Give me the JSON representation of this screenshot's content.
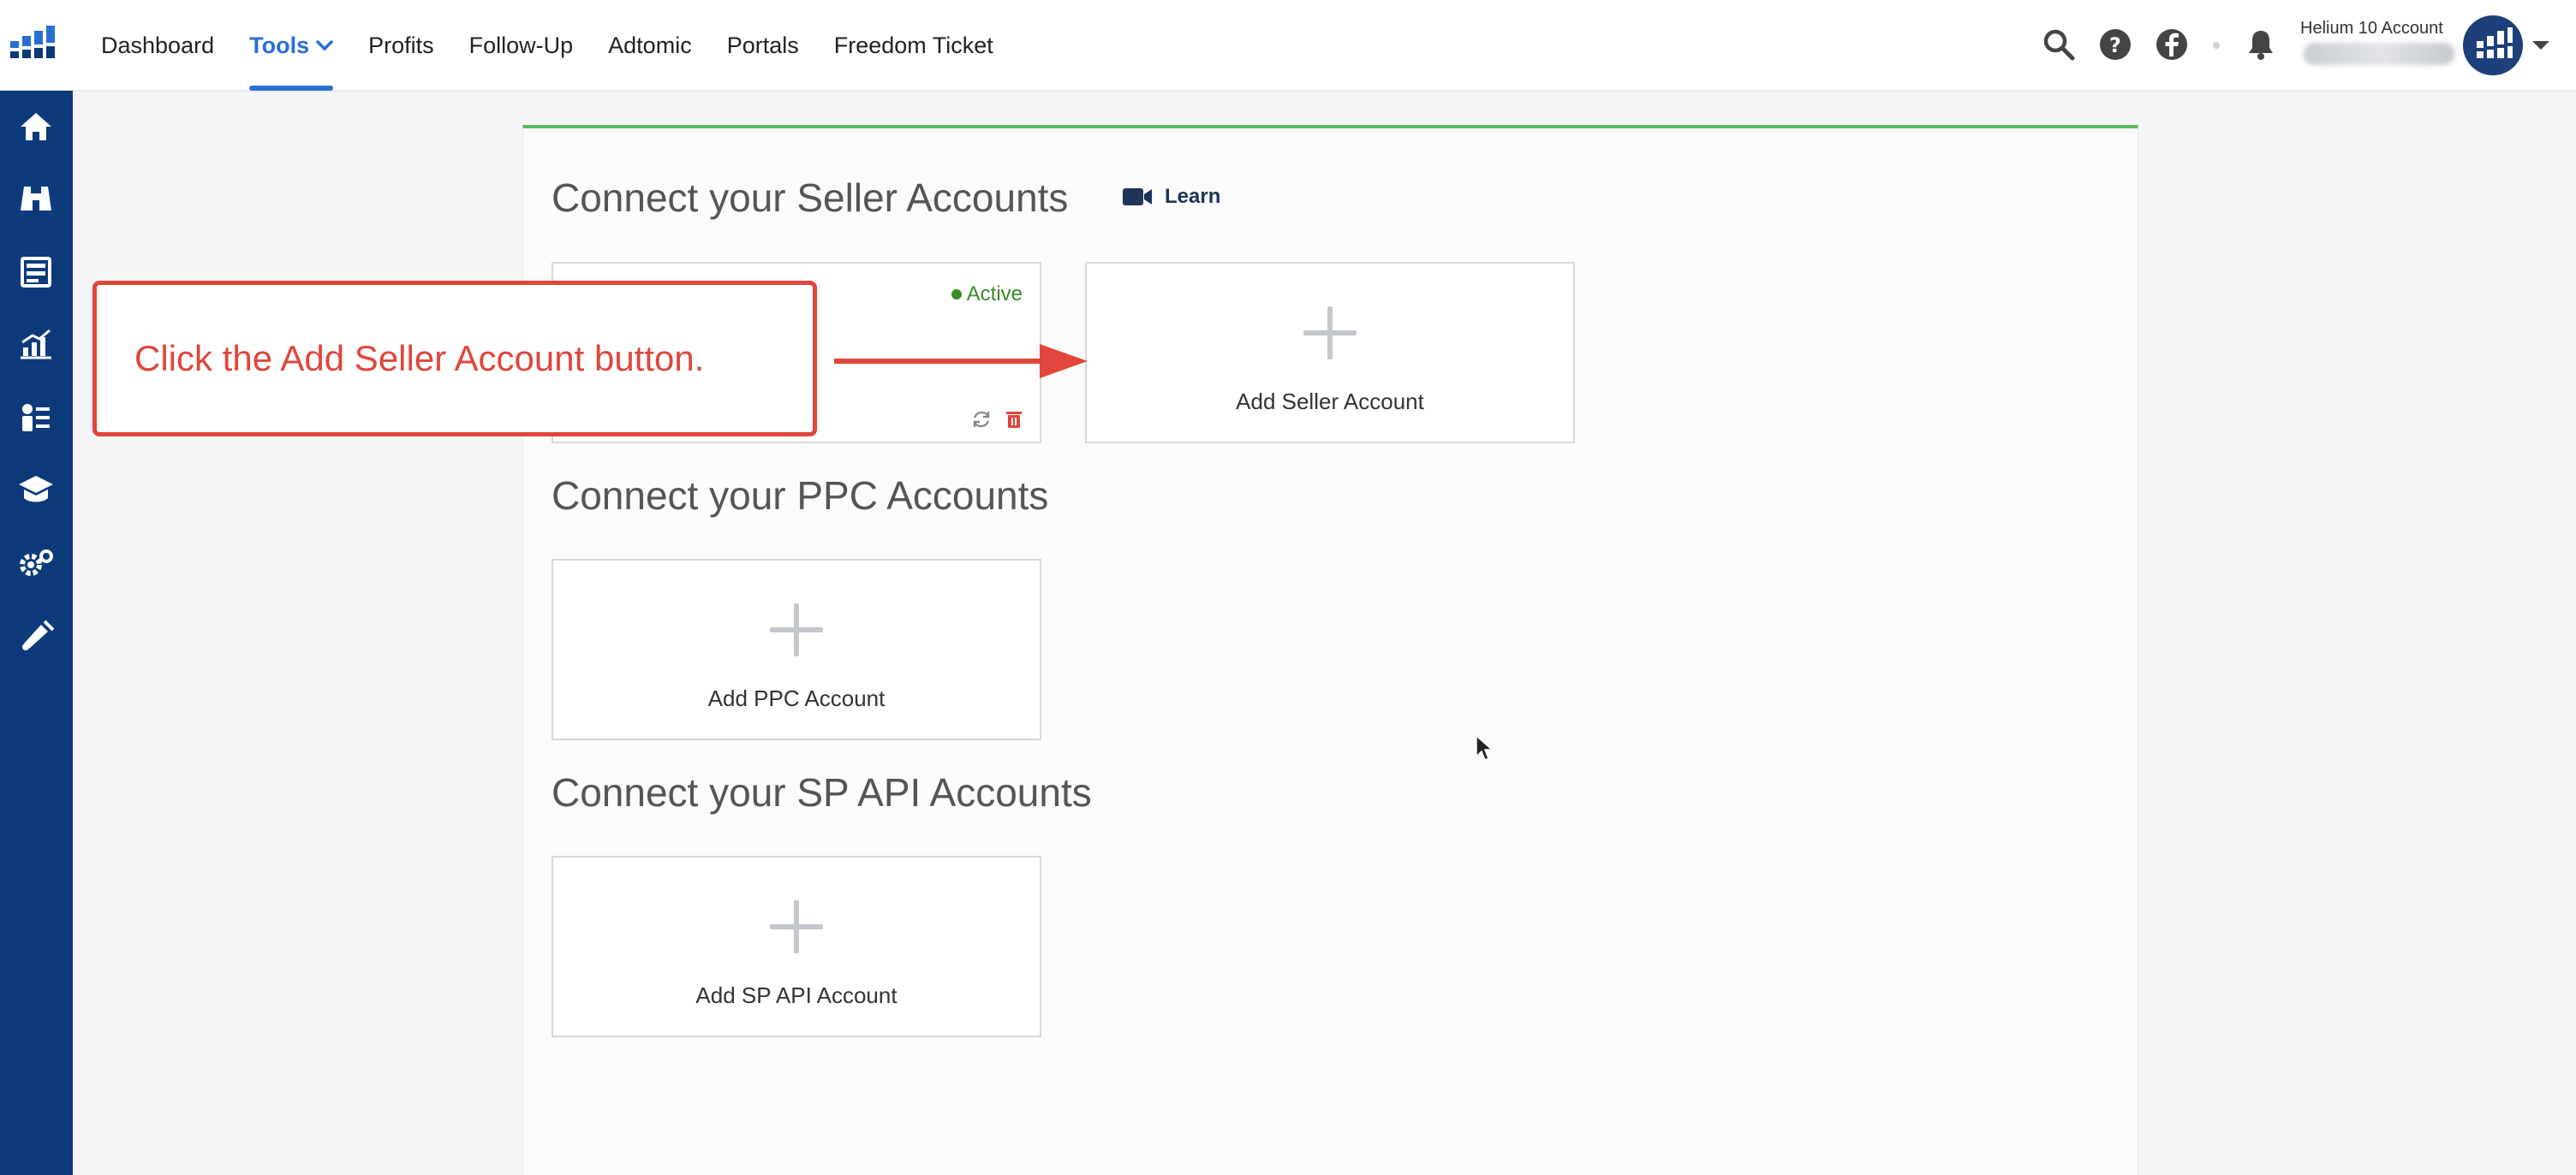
{
  "nav": {
    "items": [
      {
        "label": "Dashboard",
        "active": false
      },
      {
        "label": "Tools",
        "active": true,
        "dropdown": true
      },
      {
        "label": "Profits",
        "active": false
      },
      {
        "label": "Follow-Up",
        "active": false
      },
      {
        "label": "Adtomic",
        "active": false
      },
      {
        "label": "Portals",
        "active": false
      },
      {
        "label": "Freedom Ticket",
        "active": false
      }
    ]
  },
  "header_right": {
    "icons": [
      "search-icon",
      "help-icon",
      "facebook-icon",
      "notification-bell-icon"
    ],
    "account_label": "Helium 10 Account"
  },
  "sidebar": {
    "icons": [
      "home-icon",
      "binoculars-icon",
      "listing-icon",
      "analytics-icon",
      "operations-icon",
      "academy-icon",
      "settings-icon",
      "marketing-icon"
    ]
  },
  "sections": {
    "seller": {
      "title": "Connect your Seller Accounts",
      "learn_label": "Learn",
      "add_label": "Add Seller Account",
      "active_status": "Active"
    },
    "ppc": {
      "title": "Connect your PPC Accounts",
      "add_label": "Add PPC Account"
    },
    "spapi": {
      "title": "Connect your SP API Accounts",
      "add_label": "Add SP API Account"
    }
  },
  "callout": {
    "text": "Click the Add Seller Account button."
  },
  "colors": {
    "brand_navy": "#0d3a7a",
    "accent_blue": "#2a6fd6",
    "success_green": "#5cb85c",
    "callout_red": "#e0463b"
  }
}
